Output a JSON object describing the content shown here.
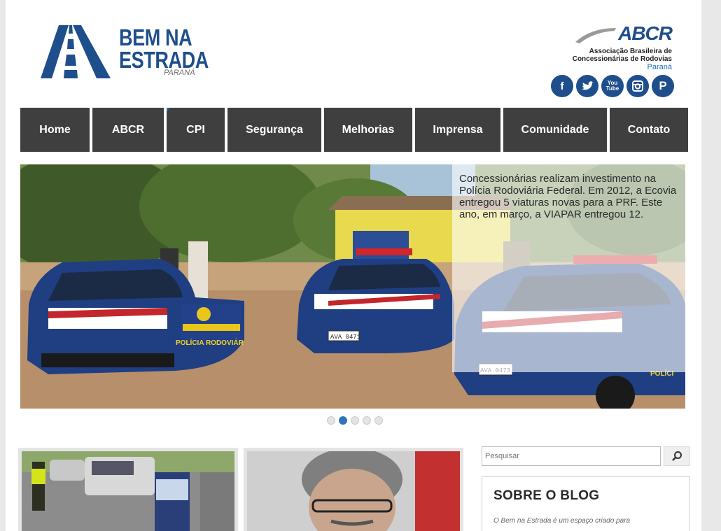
{
  "header": {
    "logo": {
      "title": "BEM NA\nESTRADA",
      "subtitle": "PARANÁ"
    },
    "partner": {
      "name": "ABCR",
      "description_line1": "Associação Brasileira de",
      "description_line2": "Concessionárias de Rodovias",
      "region": "Paraná"
    },
    "social": [
      {
        "icon": "facebook-icon",
        "glyph": "f"
      },
      {
        "icon": "twitter-icon",
        "glyph": "t"
      },
      {
        "icon": "youtube-icon",
        "glyph": "You\nTube"
      },
      {
        "icon": "instagram-icon",
        "glyph": "◙"
      },
      {
        "icon": "pinterest-icon",
        "glyph": "P"
      }
    ]
  },
  "nav": {
    "items": [
      {
        "label": "Home"
      },
      {
        "label": "ABCR"
      },
      {
        "label": "CPI"
      },
      {
        "label": "Segurança"
      },
      {
        "label": "Melhorias"
      },
      {
        "label": "Imprensa"
      },
      {
        "label": "Comunidade"
      },
      {
        "label": "Contato"
      }
    ]
  },
  "slider": {
    "caption": "Concessionárias realizam investimento na Polícia Rodoviária Federal. Em 2012, a Ecovia entregou 5 viaturas novas para a PRF. Este ano, em março, a VIAPAR entregou 12.",
    "plates": [
      "AVA 0471",
      "AVA 0473"
    ],
    "door_text": "POLÍCIA RODOVIÁR",
    "door_text_right": "POLÍCI",
    "dots_count": 5,
    "active_dot": 2
  },
  "sidebar": {
    "search_placeholder": "Pesquisar",
    "blog_title": "SOBRE O BLOG",
    "blog_text": "O Bem na Estrada é um espaço criado para"
  },
  "colors": {
    "brand_blue": "#1f4e8c",
    "nav_bg": "#3f3f3f",
    "accent_blue": "#1f6ebd"
  }
}
